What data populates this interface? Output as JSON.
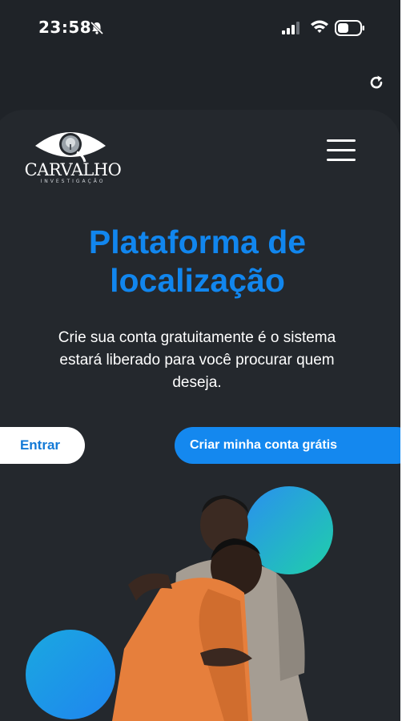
{
  "status_bar": {
    "time": "23:58",
    "icons": [
      "bell-slash-icon",
      "cellular-signal-icon",
      "wifi-icon",
      "battery-icon"
    ]
  },
  "browser": {
    "reload_icon": "reload-icon"
  },
  "header": {
    "logo_text": "CARVALHO",
    "logo_subtext": "INVESTIGAÇÃO",
    "menu_icon": "hamburger-menu-icon"
  },
  "hero": {
    "headline_line1": "Plataforma de",
    "headline_line2": "localização",
    "subtitle": "Crie sua conta gratuitamente é o sistema estará liberado para você procurar quem deseja."
  },
  "actions": {
    "login_label": "Entrar",
    "signup_label": "Criar minha conta grátis"
  },
  "colors": {
    "background": "#1f2328",
    "card": "#24282d",
    "accent_blue": "#1488ef",
    "accent_teal": "#1fd0a9"
  }
}
